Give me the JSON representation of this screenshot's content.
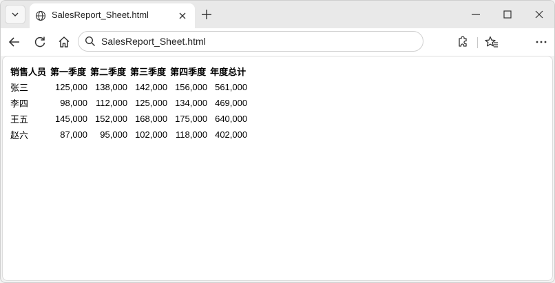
{
  "browser": {
    "tab": {
      "title": "SalesReport_Sheet.html"
    },
    "address": {
      "url": "SalesReport_Sheet.html"
    }
  },
  "report": {
    "headers": [
      "销售人员",
      "第一季度",
      "第二季度",
      "第三季度",
      "第四季度",
      "年度总计"
    ],
    "rows": [
      [
        "张三",
        "125,000",
        "138,000",
        "142,000",
        "156,000",
        "561,000"
      ],
      [
        "李四",
        "98,000",
        "112,000",
        "125,000",
        "134,000",
        "469,000"
      ],
      [
        "王五",
        "145,000",
        "152,000",
        "168,000",
        "175,000",
        "640,000"
      ],
      [
        "赵六",
        "87,000",
        "95,000",
        "102,000",
        "118,000",
        "402,000"
      ]
    ]
  }
}
